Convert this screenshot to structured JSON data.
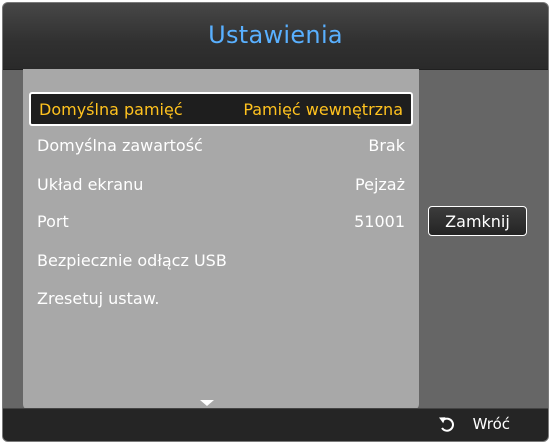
{
  "dialog": {
    "title": "Ustawienia"
  },
  "settings": {
    "items": [
      {
        "label": "Domyślna pamięć",
        "value": "Pamięć wewnętrzna",
        "selected": true
      },
      {
        "label": "Domyślna zawartość",
        "value": "Brak",
        "selected": false
      },
      {
        "label": "Układ ekranu",
        "value": "Pejzaż",
        "selected": false
      },
      {
        "label": "Port",
        "value": "51001",
        "selected": false
      },
      {
        "label": "Bezpiecznie odłącz USB",
        "value": "",
        "selected": false
      },
      {
        "label": "Zresetuj ustaw.",
        "value": "",
        "selected": false
      }
    ],
    "scroll_icon": "scroll-down-arrow-icon"
  },
  "actions": {
    "close_label": "Zamknij"
  },
  "footer": {
    "back_label": "Wróć",
    "back_icon": "return-arrow-icon"
  },
  "colors": {
    "title": "#59b0ff",
    "selected_text": "#ffc21e",
    "list_background": "#a8a8a8",
    "dialog_background": "#666666"
  }
}
